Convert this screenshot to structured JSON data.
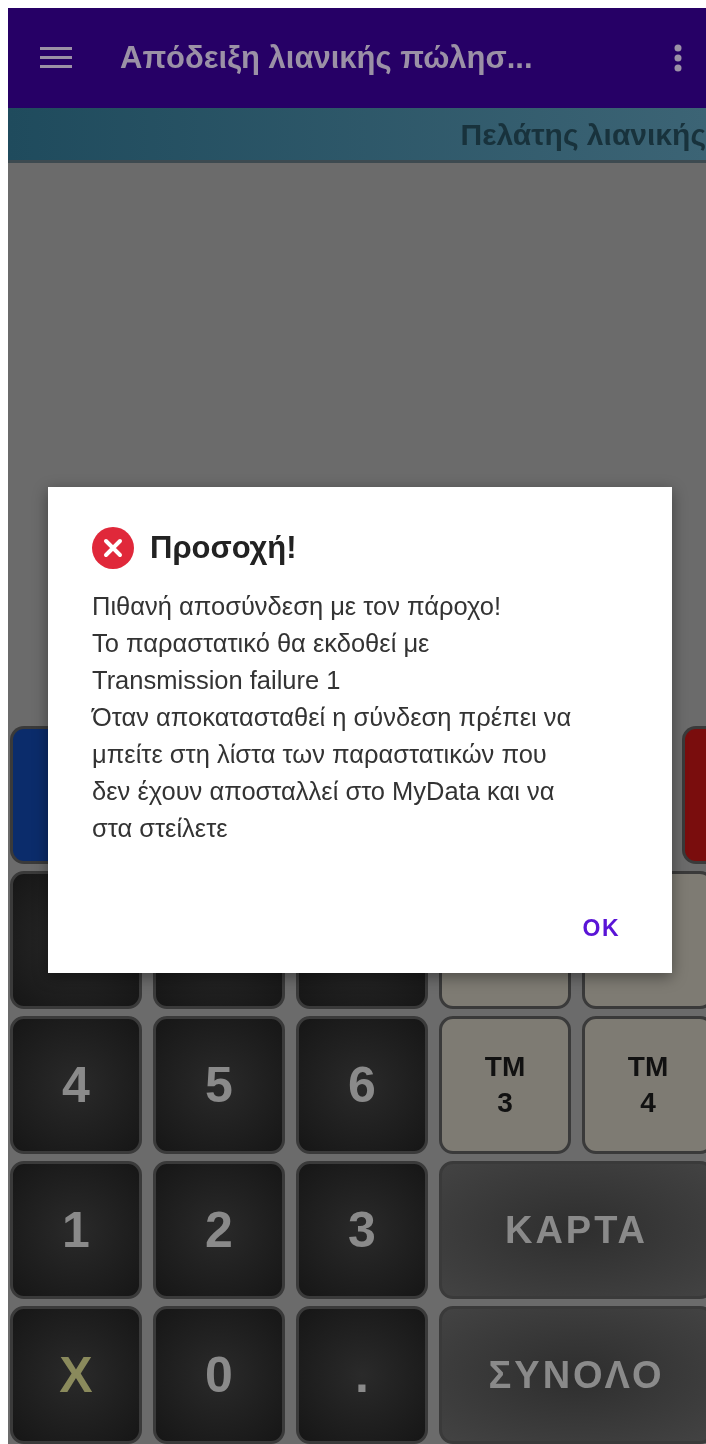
{
  "app_bar": {
    "title": "Απόδειξη λιανικής πώλησ..."
  },
  "customer_bar": {
    "label": "Πελάτης λιανικής"
  },
  "keypad": [
    [
      {
        "kind": "primary"
      },
      {
        "kind": "danger"
      }
    ],
    [
      {
        "kind": "digit"
      },
      {
        "kind": "digit"
      },
      {
        "kind": "digit"
      },
      {
        "kind": "tm"
      },
      {
        "kind": "tm"
      }
    ],
    [
      {
        "kind": "digit",
        "label": "4"
      },
      {
        "kind": "digit",
        "label": "5"
      },
      {
        "kind": "digit",
        "label": "6"
      },
      {
        "kind": "tm",
        "label": "ΤΜ\n3"
      },
      {
        "kind": "tm",
        "label": "ΤΜ\n4"
      }
    ],
    [
      {
        "kind": "digit",
        "label": "1"
      },
      {
        "kind": "digit",
        "label": "2"
      },
      {
        "kind": "digit",
        "label": "3"
      },
      {
        "kind": "wide",
        "label": "ΚΑΡΤΑ"
      }
    ],
    [
      {
        "kind": "times",
        "label": "X"
      },
      {
        "kind": "digit",
        "label": "0"
      },
      {
        "kind": "digit",
        "label": "."
      },
      {
        "kind": "wide",
        "label": "ΣΥΝΟΛΟ"
      }
    ]
  ],
  "dialog": {
    "title": "Προσοχή!",
    "message": "Πιθανή αποσύνδεση με τον πάροχο!\nΤο παραστατικό θα εκδοθεί με\nTransmission failure 1\nΌταν αποκατασταθεί η σύνδεση πρέπει να μπείτε στη λίστα των παραστατικών που δεν έχουν αποσταλλεί στο MyData και να στα στείλετε",
    "button": "OK"
  }
}
